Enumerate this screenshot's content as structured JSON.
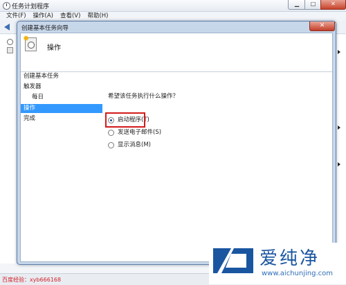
{
  "app": {
    "title": "任务计划程序",
    "menu": [
      "文件(F)",
      "操作(A)",
      "查看(V)",
      "帮助(H)"
    ],
    "window_controls": {
      "minimize": "▁",
      "maximize": "□",
      "close": "✕"
    }
  },
  "dialog": {
    "title": "创建基本任务向导",
    "close": "✕",
    "header_title": "操作",
    "steps": [
      {
        "label": "创建基本任务",
        "selected": false,
        "indent": false
      },
      {
        "label": "触发器",
        "selected": false,
        "indent": false
      },
      {
        "label": "每日",
        "selected": false,
        "indent": true
      },
      {
        "label": "操作",
        "selected": true,
        "indent": false
      },
      {
        "label": "完成",
        "selected": false,
        "indent": false
      }
    ],
    "question": "希望该任务执行什么操作？",
    "options": [
      {
        "label": "启动程序(T)",
        "checked": true
      },
      {
        "label": "发送电子邮件(S)",
        "checked": false
      },
      {
        "label": "显示消息(M)",
        "checked": false
      }
    ]
  },
  "status_text": "百度经验：xyb666168",
  "watermark": {
    "main": "爱纯净",
    "site": "www.aichunjing.com"
  },
  "colors": {
    "selection": "#3399ff",
    "highlight": "#d31a1a",
    "watermark": "#1a56a0"
  }
}
